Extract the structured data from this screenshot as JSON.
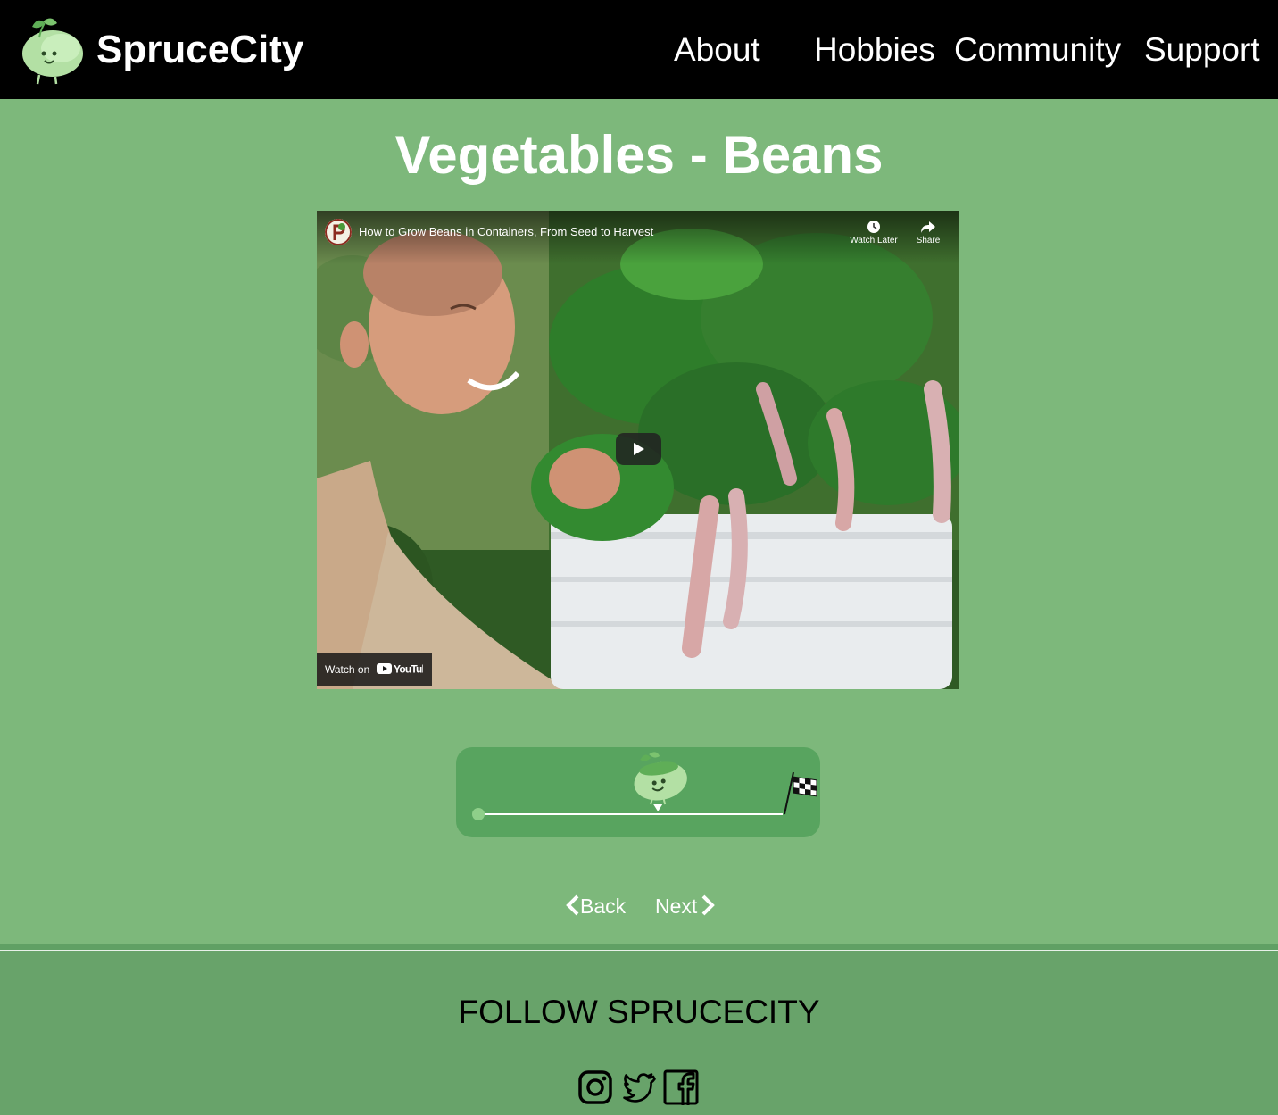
{
  "header": {
    "brand": "SpruceCity",
    "logo_icon": "bean-mascot-icon",
    "nav": [
      {
        "label": "About"
      },
      {
        "label": "Hobbies"
      },
      {
        "label": "Community"
      },
      {
        "label": "Support"
      }
    ]
  },
  "page": {
    "title": "Vegetables - Beans"
  },
  "video": {
    "title": "How to Grow Beans in Containers, From Seed to Harvest",
    "watch_later": "Watch Later",
    "share": "Share",
    "watch_on": "Watch on",
    "platform": "YouTube"
  },
  "progress": {
    "level": 0.59,
    "mascot_icon": "bean-mascot-icon",
    "finish_icon": "checkered-flag-icon"
  },
  "pager": {
    "back": "Back",
    "next": "Next"
  },
  "footer": {
    "follow": "FOLLOW SPRUCECITY",
    "social": [
      {
        "icon": "instagram-icon"
      },
      {
        "icon": "twitter-icon"
      },
      {
        "icon": "facebook-icon"
      }
    ]
  },
  "colors": {
    "header_bg": "#000000",
    "page_bg": "#7db87b",
    "progress_bg": "#58a45f",
    "footer_bg": "#68a36a"
  }
}
